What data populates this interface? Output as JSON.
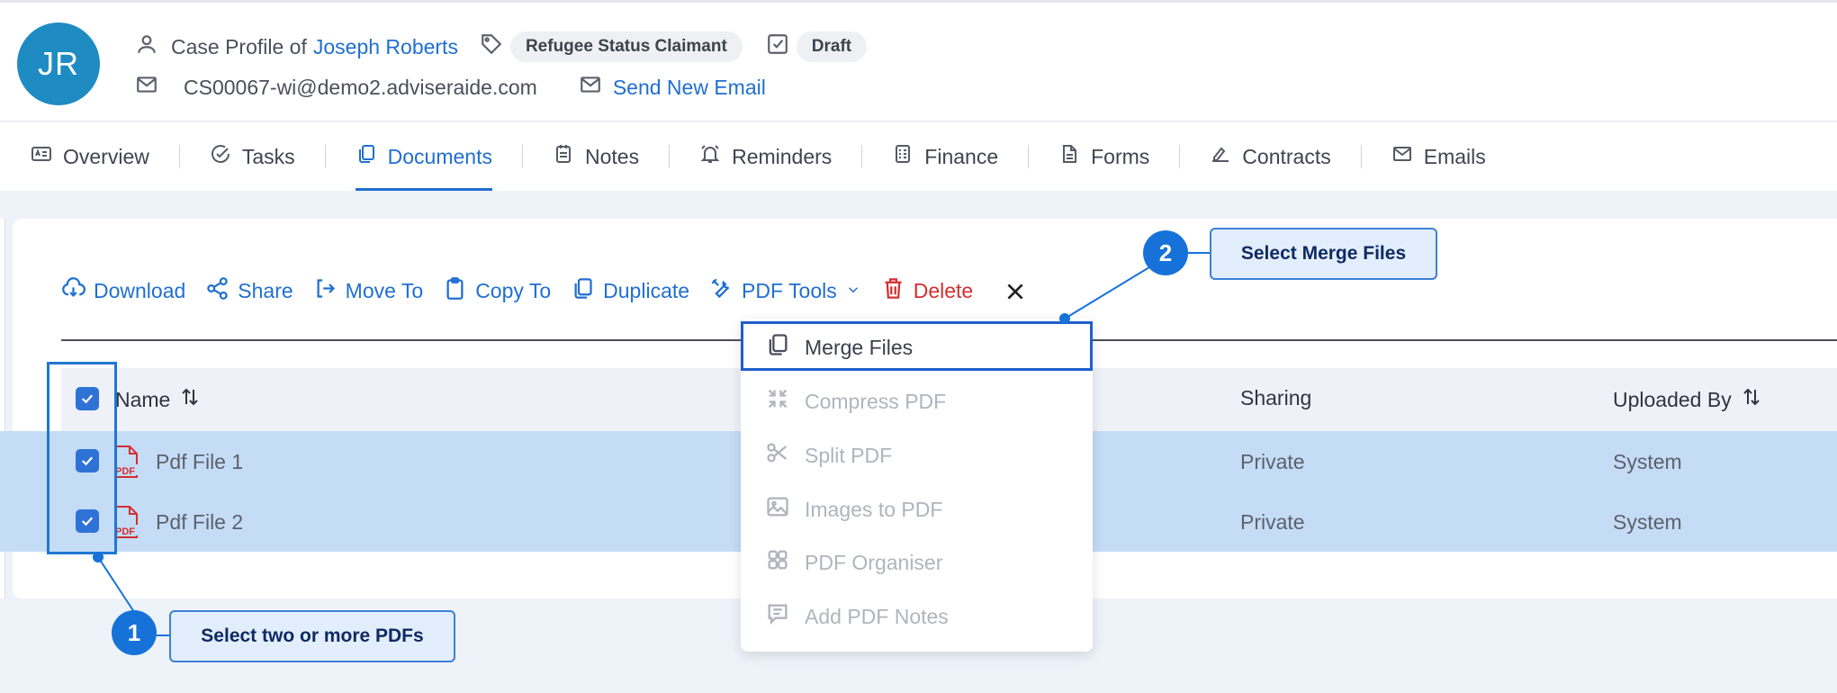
{
  "header": {
    "avatar_initials": "JR",
    "case_profile_prefix": "Case Profile of",
    "client_name": "Joseph Roberts",
    "status_tag": "Refugee Status Claimant",
    "state_tag": "Draft",
    "email": "CS00067-wi@demo2.adviseraide.com",
    "send_email_label": "Send New Email"
  },
  "tabs": [
    {
      "label": "Overview",
      "icon": "id-card-icon"
    },
    {
      "label": "Tasks",
      "icon": "check-circle-icon"
    },
    {
      "label": "Documents",
      "icon": "documents-icon",
      "active": true
    },
    {
      "label": "Notes",
      "icon": "notes-icon"
    },
    {
      "label": "Reminders",
      "icon": "bell-icon"
    },
    {
      "label": "Finance",
      "icon": "finance-icon"
    },
    {
      "label": "Forms",
      "icon": "form-icon"
    },
    {
      "label": "Contracts",
      "icon": "signature-icon"
    },
    {
      "label": "Emails",
      "icon": "mail-icon"
    }
  ],
  "toolbar": {
    "download": "Download",
    "share": "Share",
    "move_to": "Move To",
    "copy_to": "Copy To",
    "duplicate": "Duplicate",
    "pdf_tools": "PDF Tools",
    "delete": "Delete"
  },
  "table": {
    "columns": [
      "Name",
      "Sharing",
      "Uploaded By"
    ],
    "rows": [
      {
        "name": "Pdf File 1",
        "sharing": "Private",
        "uploaded_by": "System"
      },
      {
        "name": "Pdf File 2",
        "sharing": "Private",
        "uploaded_by": "System"
      }
    ]
  },
  "pdf_tools_menu": [
    {
      "label": "Merge Files",
      "enabled": true
    },
    {
      "label": "Compress PDF",
      "enabled": false
    },
    {
      "label": "Split PDF",
      "enabled": false
    },
    {
      "label": "Images to PDF",
      "enabled": false
    },
    {
      "label": "PDF Organiser",
      "enabled": false
    },
    {
      "label": "Add PDF Notes",
      "enabled": false
    }
  ],
  "pdf_icon_text": "PDF",
  "annotations": [
    {
      "number": "1",
      "text": "Select two or more PDFs"
    },
    {
      "number": "2",
      "text": "Select Merge Files"
    }
  ],
  "colors": {
    "accent": "#1f6fd1",
    "danger": "#d32f2f",
    "selected_row": "#c5dcf6",
    "avatar": "#1e8bc3"
  }
}
